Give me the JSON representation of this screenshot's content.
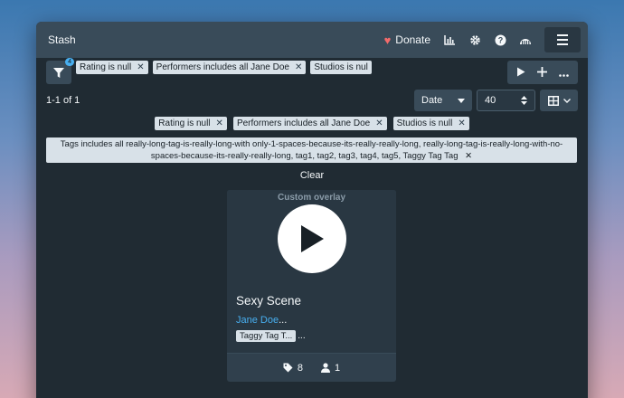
{
  "navbar": {
    "brand": "Stash",
    "donate_label": "Donate"
  },
  "toolbar": {
    "filter_count": "4",
    "chips": [
      {
        "label": "Rating is null"
      },
      {
        "label": "Performers includes all Jane Doe"
      },
      {
        "label": "Studios is nul"
      }
    ]
  },
  "list": {
    "result_count": "1-1 of 1",
    "sort_by": "Date",
    "per_page": "40"
  },
  "filters": {
    "tags": [
      {
        "label": "Rating is null"
      },
      {
        "label": "Performers includes all Jane Doe"
      },
      {
        "label": "Studios is null"
      }
    ],
    "long_tag": "Tags includes all really-long-tag-is-really-long-with only-1-spaces-because-its-really-really-long, really-long-tag-is-really-long-with-no-spaces-because-its-really-really-long, tag1, tag2, tag3, tag4, tag5, Taggy Tag Tag",
    "clear_label": "Clear"
  },
  "card": {
    "overlay": "Custom overlay",
    "title": "Sexy Scene",
    "performer": "Jane Doe",
    "performer_ellipsis": "...",
    "tag": "Taggy Tag T...",
    "tag_ellipsis": "...",
    "tag_count": "8",
    "performer_count": "1"
  },
  "colors": {
    "navbar": "#394b59",
    "background": "#202b33",
    "link": "#48aff0",
    "heart": "#f36b6b"
  }
}
